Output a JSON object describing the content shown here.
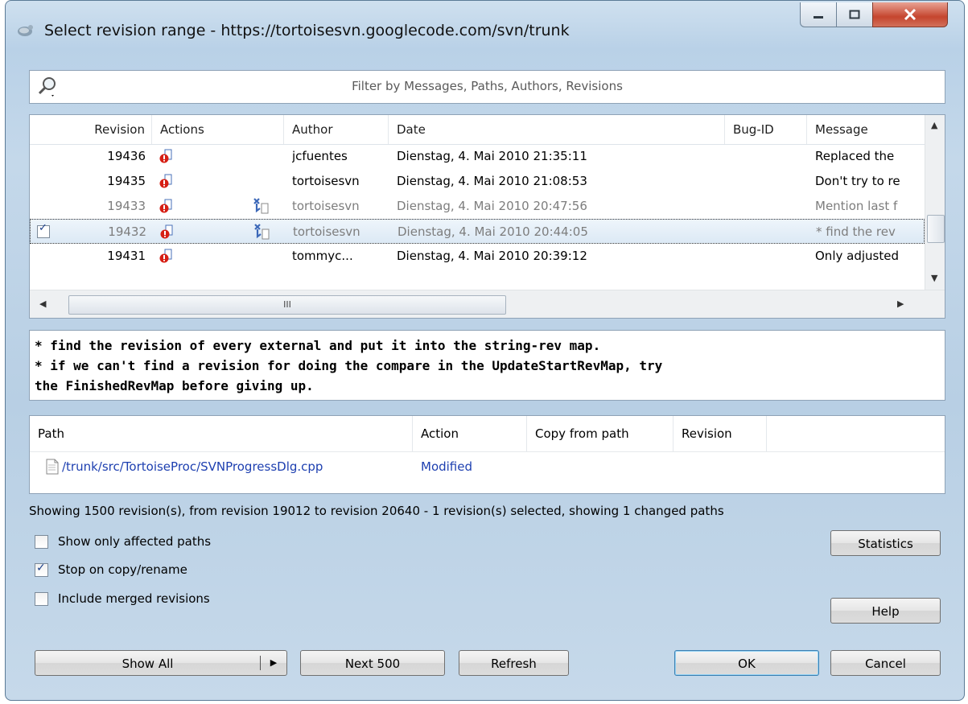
{
  "window": {
    "title": "Select revision range - https://tortoisesvn.googlecode.com/svn/trunk",
    "controls": {
      "minimize_icon": "minimize-icon",
      "maximize_icon": "maximize-icon",
      "close_icon": "close-icon"
    }
  },
  "filter": {
    "placeholder": "Filter by Messages, Paths, Authors, Revisions",
    "icon": "search-filter-icon"
  },
  "log": {
    "columns": [
      "Revision",
      "Actions",
      "Author",
      "Date",
      "Bug-ID",
      "Message"
    ],
    "rows": [
      {
        "revision": "19436",
        "author": "jcfuentes",
        "date": "Dienstag, 4. Mai 2010 21:35:11",
        "message": "Replaced the",
        "dimmed": false,
        "selected": false,
        "checked": false,
        "copy_icon": false
      },
      {
        "revision": "19435",
        "author": "tortoisesvn",
        "date": "Dienstag, 4. Mai 2010 21:08:53",
        "message": "Don't try to re",
        "dimmed": false,
        "selected": false,
        "checked": false,
        "copy_icon": false
      },
      {
        "revision": "19433",
        "author": "tortoisesvn",
        "date": "Dienstag, 4. Mai 2010 20:47:56",
        "message": "Mention last f",
        "dimmed": true,
        "selected": false,
        "checked": false,
        "copy_icon": true
      },
      {
        "revision": "19432",
        "author": "tortoisesvn",
        "date": "Dienstag, 4. Mai 2010 20:44:05",
        "message": "* find the rev",
        "dimmed": true,
        "selected": true,
        "checked": true,
        "copy_icon": true
      },
      {
        "revision": "19431",
        "author": "tommyc...",
        "date": "Dienstag, 4. Mai 2010 20:39:12",
        "message": "Only adjusted",
        "dimmed": false,
        "selected": false,
        "checked": false,
        "copy_icon": false
      }
    ],
    "hscroll_thumb_label": "III"
  },
  "message": {
    "lines": [
      "* find the revision of every external and put it into the string-rev map.",
      "* if we can't find a revision for doing the compare in the UpdateStartRevMap, try",
      "the FinishedRevMap before giving up."
    ]
  },
  "paths": {
    "columns": [
      "Path",
      "Action",
      "Copy from path",
      "Revision"
    ],
    "rows": [
      {
        "path": "/trunk/src/TortoiseProc/SVNProgressDlg.cpp",
        "action": "Modified",
        "copy_from": "",
        "revision": ""
      }
    ]
  },
  "status": "Showing 1500 revision(s), from revision 19012 to revision 20640 - 1 revision(s) selected, showing 1 changed paths",
  "options": {
    "show_only_affected": {
      "label": "Show only affected paths",
      "checked": false
    },
    "stop_on_copy": {
      "label": "Stop on copy/rename",
      "checked": true
    },
    "include_merged": {
      "label": "Include merged revisions",
      "checked": false
    }
  },
  "buttons": {
    "statistics": "Statistics",
    "help": "Help",
    "show_all": "Show All",
    "next_500": "Next 500",
    "refresh": "Refresh",
    "ok": "OK",
    "cancel": "Cancel"
  },
  "colors": {
    "accent": "#3c7fb1",
    "link": "#1d3fb0",
    "close": "#c5452e"
  }
}
